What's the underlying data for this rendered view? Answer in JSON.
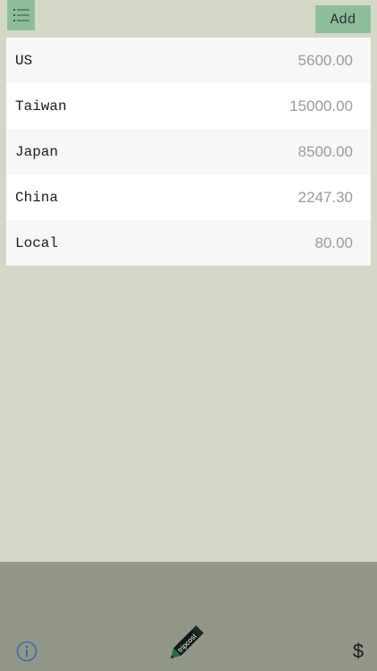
{
  "toolbar": {
    "menu_icon": "list-icon",
    "add_label": "Add"
  },
  "currencies": [
    {
      "name": "US",
      "amount": "5600.00"
    },
    {
      "name": "Taiwan",
      "amount": "15000.00"
    },
    {
      "name": "Japan",
      "amount": "8500.00"
    },
    {
      "name": "China",
      "amount": "2247.30"
    },
    {
      "name": "Local",
      "amount": "80.00"
    }
  ],
  "bottom_bar": {
    "info_icon": "info-icon",
    "logo_text": "tripcost",
    "dollar_label": "$"
  },
  "colors": {
    "background": "#d4d8c6",
    "button_green": "#8bbf99",
    "bottom_bar": "#939788",
    "info_blue": "#2f6fb0"
  }
}
